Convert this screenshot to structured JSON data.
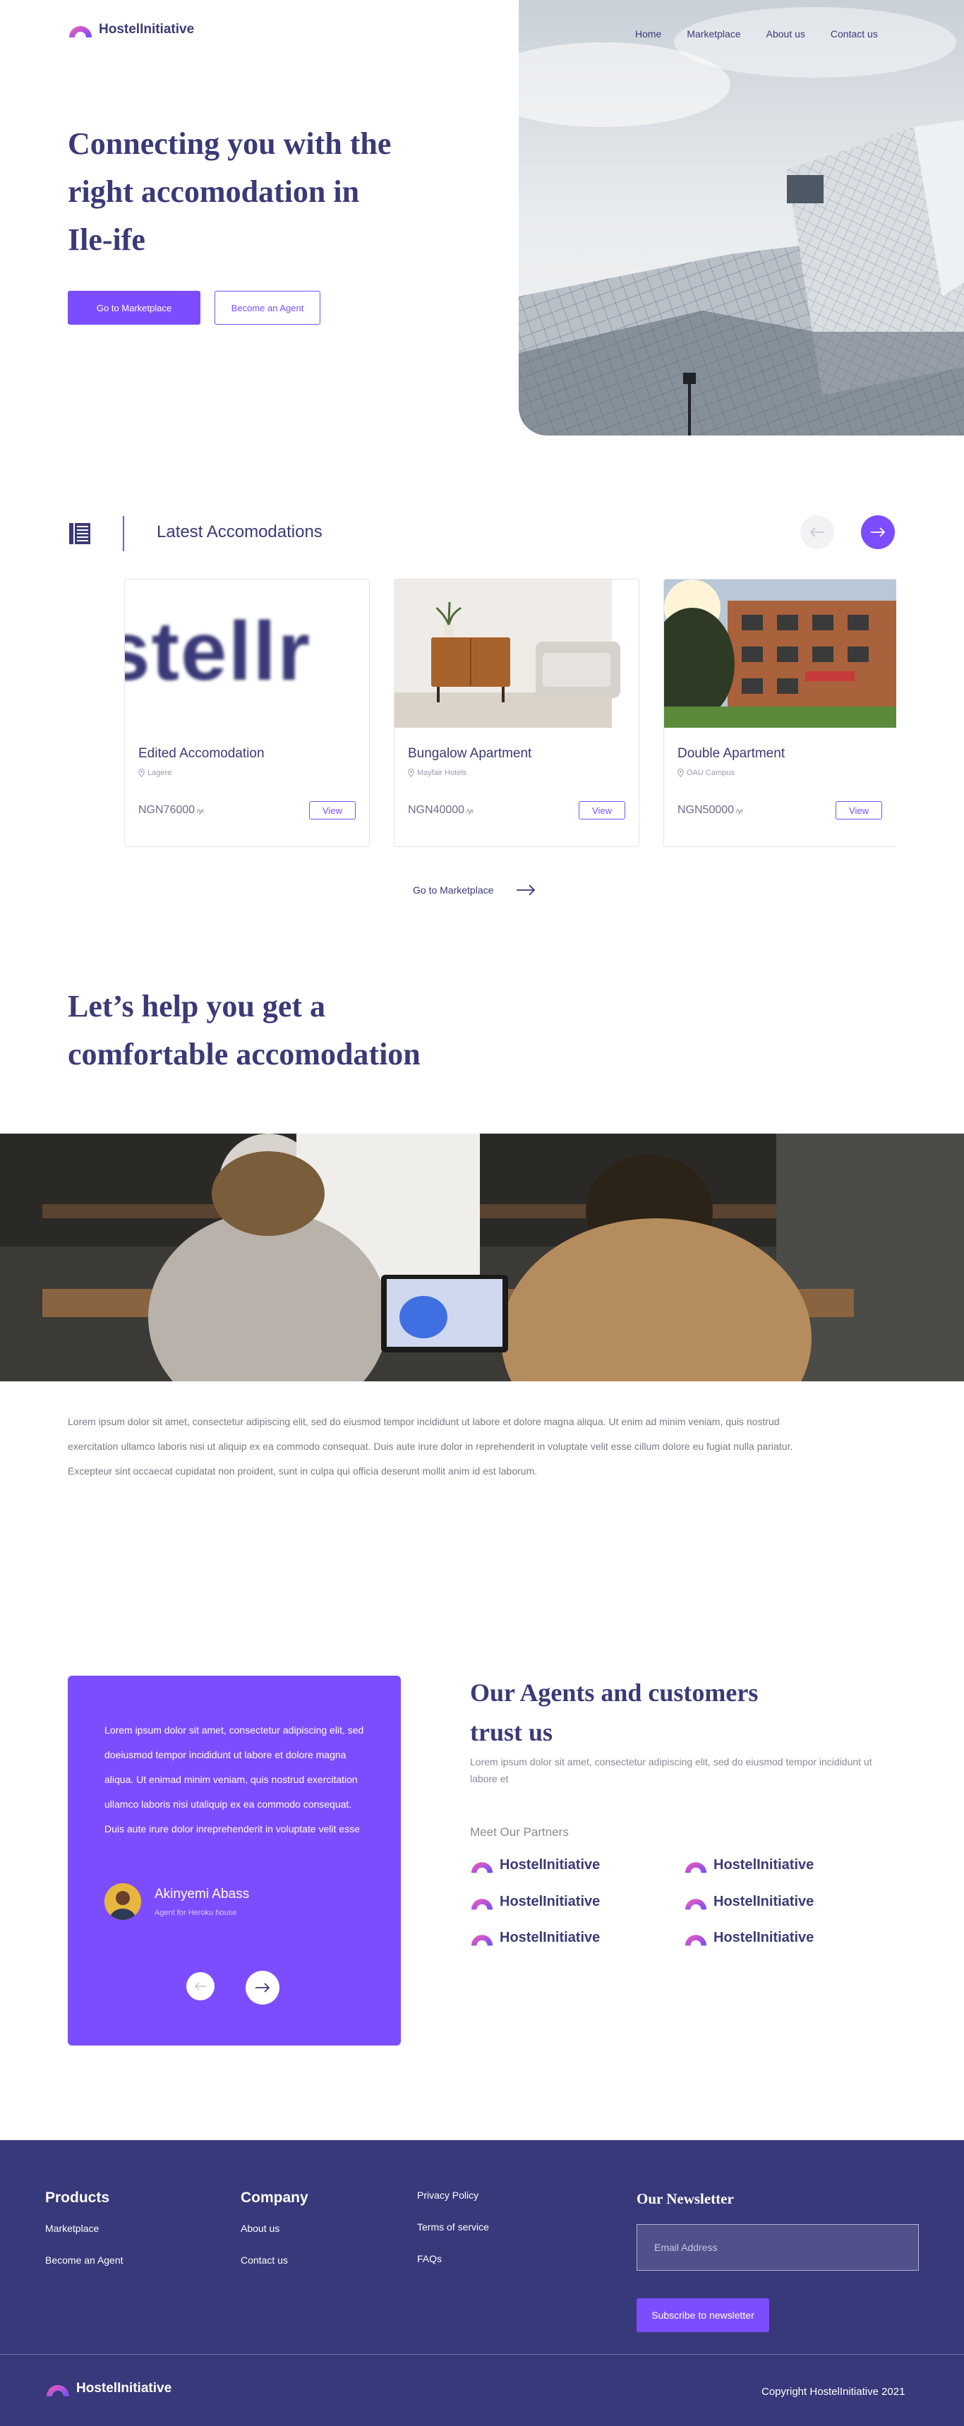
{
  "brand": {
    "name": "HostelInitiative"
  },
  "nav": {
    "items": [
      "Home",
      "Marketplace",
      "About us",
      "Contact us"
    ]
  },
  "hero": {
    "title_line1": "Connecting you with the",
    "title_line2": "right accomodation in",
    "title_line3": "Ile-ife",
    "primary_button": "Go to Marketplace",
    "secondary_button": "Become an Agent"
  },
  "latest": {
    "title": "Latest Accomodations",
    "cards": [
      {
        "title": "Edited Accomodation",
        "location": "Lagere",
        "price": "NGN76000",
        "unit": "/yr",
        "action": "View"
      },
      {
        "title": "Bungalow Apartment",
        "location": "Mayfair Hotels",
        "price": "NGN40000",
        "unit": "/yr",
        "action": "View"
      },
      {
        "title": "Double Apartment",
        "location": "OAU Campus",
        "price": "NGN50000",
        "unit": "/yr",
        "action": "View"
      }
    ],
    "marketplace_link": "Go to Marketplace",
    "card1_watermark": "stellr"
  },
  "help": {
    "title_line1": "Let’s help you get a",
    "title_line2": "comfortable accomodation",
    "paragraph": "Lorem ipsum dolor sit amet, consectetur adipiscing elit, sed do eiusmod tempor incididunt ut labore et dolore magna aliqua. Ut enim ad minim veniam, quis nostrud exercitation ullamco laboris nisi ut aliquip ex ea commodo consequat. Duis aute irure dolor in reprehenderit in voluptate velit esse cillum dolore eu fugiat nulla pariatur. Excepteur sint occaecat cupidatat non proident, sunt in culpa qui officia deserunt mollit anim id est laborum."
  },
  "testimonial": {
    "quote": "Lorem ipsum dolor sit amet, consectetur adipiscing elit, sed doeiusmod tempor incididunt ut labore et dolore magna aliqua. Ut enimad minim veniam, quis nostrud exercitation ullamco laboris nisi utaliquip ex ea commodo consequat. Duis aute irure dolor inreprehenderit in voluptate velit esse",
    "name": "Akinyemi Abass",
    "role": "Agent for Heroku house"
  },
  "agents": {
    "title_line1": "Our Agents and customers",
    "title_line2": "trust us",
    "subtitle": "Lorem ipsum dolor sit amet, consectetur adipiscing elit, sed do eiusmod tempor incididunt ut labore et",
    "partners_heading": "Meet Our Partners",
    "partners": [
      "HostelInitiative",
      "HostelInitiative",
      "HostelInitiative",
      "HostelInitiative",
      "HostelInitiative",
      "HostelInitiative"
    ]
  },
  "footer": {
    "products_title": "Products",
    "products": [
      "Marketplace",
      "Become an Agent"
    ],
    "company_title": "Company",
    "company": [
      "About us",
      "Contact us"
    ],
    "legal": [
      "Privacy Policy",
      "Terms of service",
      "FAQs"
    ],
    "newsletter_title": "Our Newsletter",
    "email_placeholder": "Email Address",
    "subscribe": "Subscribe to newsletter",
    "copyright": "Copyright HostelInitiative 2021"
  },
  "colors": {
    "accent": "#7c4dff",
    "navy": "#38397a",
    "text_gray": "#7a7a88"
  },
  "icons": [
    "logo-mark",
    "building-icon",
    "arrow-left-icon",
    "arrow-right-icon",
    "location-pin-icon"
  ]
}
